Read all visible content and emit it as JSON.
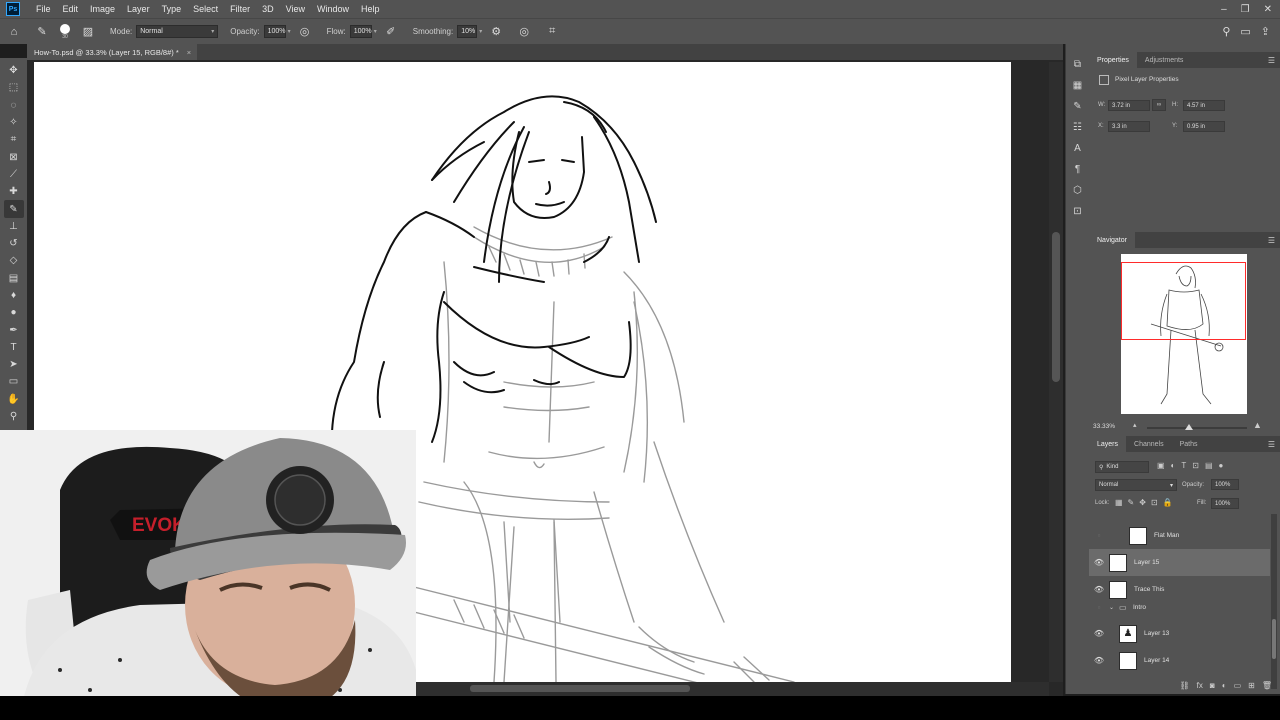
{
  "app": {
    "logo_text": "Ps",
    "menus": [
      "File",
      "Edit",
      "Image",
      "Layer",
      "Type",
      "Select",
      "Filter",
      "3D",
      "View",
      "Window",
      "Help"
    ],
    "window_controls": [
      "–",
      "❐",
      "✕"
    ]
  },
  "options": {
    "brush_size": "30",
    "mode_label": "Mode:",
    "mode_value": "Normal",
    "opacity_label": "Opacity:",
    "opacity_value": "100%",
    "flow_label": "Flow:",
    "flow_value": "100%",
    "smoothing_label": "Smoothing:",
    "smoothing_value": "10%"
  },
  "document": {
    "tab_title": "How-To.psd @ 33.3% (Layer 15, RGB/8#) *",
    "tab_close": "×"
  },
  "webcam": {
    "chair_brand": "EVOKO"
  },
  "properties": {
    "tabs": [
      "Properties",
      "Adjustments"
    ],
    "section_title": "Pixel Layer Properties",
    "w_label": "W:",
    "w_value": "3.72 in",
    "h_label": "H:",
    "h_value": "4.57 in",
    "x_label": "X:",
    "x_value": "3.3 in",
    "y_label": "Y:",
    "y_value": "0.95 in"
  },
  "navigator": {
    "title": "Navigator",
    "zoom": "33.33%"
  },
  "layers": {
    "tabs": [
      "Layers",
      "Channels",
      "Paths"
    ],
    "filter_value": "Kind",
    "blend_mode": "Normal",
    "opacity_label": "Opacity:",
    "opacity_value": "100%",
    "lock_label": "Lock:",
    "fill_label": "Fill:",
    "fill_value": "100%",
    "rows": [
      {
        "name": "Flat Man",
        "visible": false,
        "selected": false,
        "indent": true
      },
      {
        "name": "Layer 15",
        "visible": true,
        "selected": true,
        "indent": false
      },
      {
        "name": "Trace This",
        "visible": true,
        "selected": false,
        "indent": false
      },
      {
        "name": "Intro",
        "visible": false,
        "selected": false,
        "indent": false,
        "group": true
      },
      {
        "name": "Layer 13",
        "visible": true,
        "selected": false,
        "indent": true
      },
      {
        "name": "Layer 14",
        "visible": true,
        "selected": false,
        "indent": true
      }
    ]
  }
}
